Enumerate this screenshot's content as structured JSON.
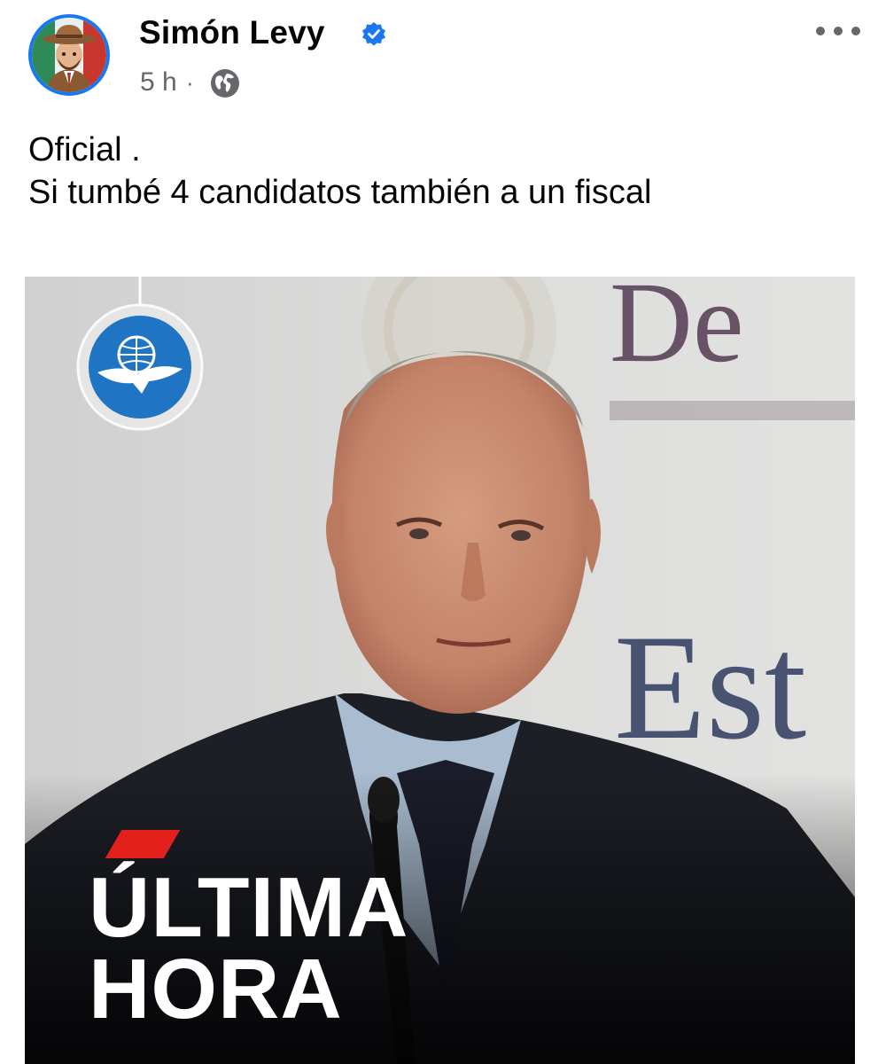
{
  "post": {
    "author": "Simón Levy",
    "verified": true,
    "time": "5 h",
    "separator": "·",
    "audience_icon": "globe-icon",
    "menu_icon": "more-horizontal-icon",
    "text_lines": [
      "Oficial .",
      "Si tumbé 4 candidatos también a un fiscal"
    ]
  },
  "image": {
    "headline_line1": "ÚLTIMA",
    "headline_line2": "HORA",
    "bg_text_top": "De",
    "bg_text_bottom": "Est",
    "logo_icon": "eagle-globe-logo-icon"
  },
  "colors": {
    "accent": "#1877f2",
    "headline_tab": "#e3201b",
    "logo_blue": "#1f75c4"
  }
}
